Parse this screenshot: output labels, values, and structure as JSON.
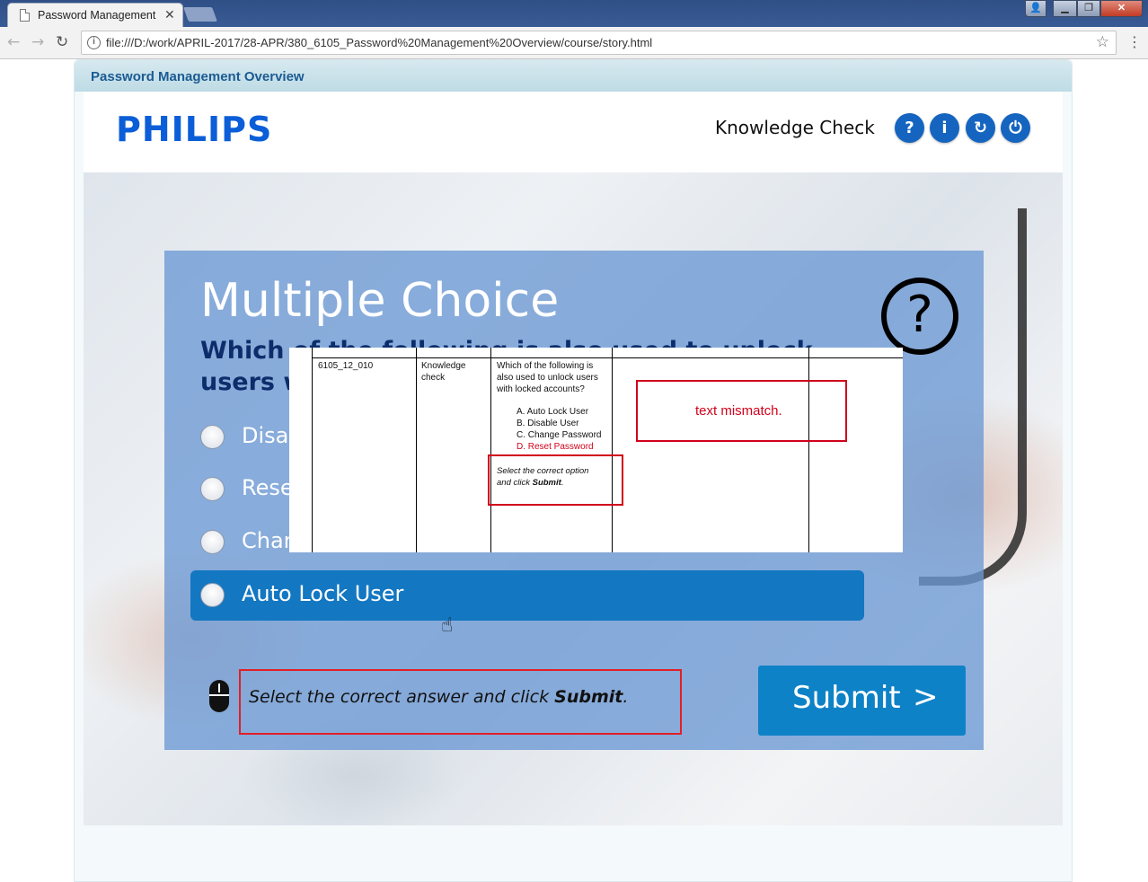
{
  "browser": {
    "tab_title": "Password Management Ov",
    "tab_close": "✕",
    "url": "file:///D:/work/APRIL-2017/28-APR/380_6105_Password%20Management%20Overview/course/story.html",
    "icons": {
      "back": "back-arrow-icon",
      "forward": "forward-arrow-icon",
      "reload": "reload-icon",
      "info": "info-icon",
      "star": "star-icon",
      "menu": "menu-icon"
    },
    "window_controls": {
      "minimize": "▁",
      "maximize": "❐",
      "close": "✕"
    }
  },
  "course": {
    "title": "Password Management Overview",
    "logo": "PHILIPS",
    "heading": "Knowledge Check",
    "header_buttons": [
      {
        "label": "?",
        "icon": "help-icon"
      },
      {
        "label": "i",
        "icon": "info-icon"
      },
      {
        "label": "↻",
        "icon": "replay-icon"
      },
      {
        "label": "⏻",
        "icon": "power-icon"
      }
    ],
    "accent": "#1565c0"
  },
  "question": {
    "type_label": "Multiple Choice",
    "text": "Which of the following is also used to unlock users with locked accounts?",
    "help_glyph": "?",
    "options": [
      {
        "label": "Disable User",
        "selected": false
      },
      {
        "label": "Reset Password",
        "selected": false
      },
      {
        "label": "Change Password",
        "selected": false
      },
      {
        "label": "Auto Lock User",
        "selected": true
      }
    ],
    "instruction_prefix": "Select the correct answer and click ",
    "instruction_bold": "Submit",
    "instruction_suffix": ".",
    "submit_label": "Submit",
    "submit_arrow": ">"
  },
  "review_snippet": {
    "slide_id": "6105_12_010",
    "type": "Knowledge check",
    "question_lines": [
      "Which of the following is",
      "also used to unlock users",
      "with locked accounts?"
    ],
    "options": [
      "A. Auto Lock User",
      "B. Disable User",
      "C. Change Password",
      "D. Reset Password"
    ],
    "instruction_line1": "Select the correct option",
    "instruction_line2_prefix": "and click ",
    "instruction_line2_bold": "Submit",
    "instruction_line2_suffix": ".",
    "comment": "text mismatch.",
    "highlight_color": "#d0021b"
  },
  "footer": {
    "audio_icon": "speaker-icon",
    "audio_glyph": "🔈"
  }
}
